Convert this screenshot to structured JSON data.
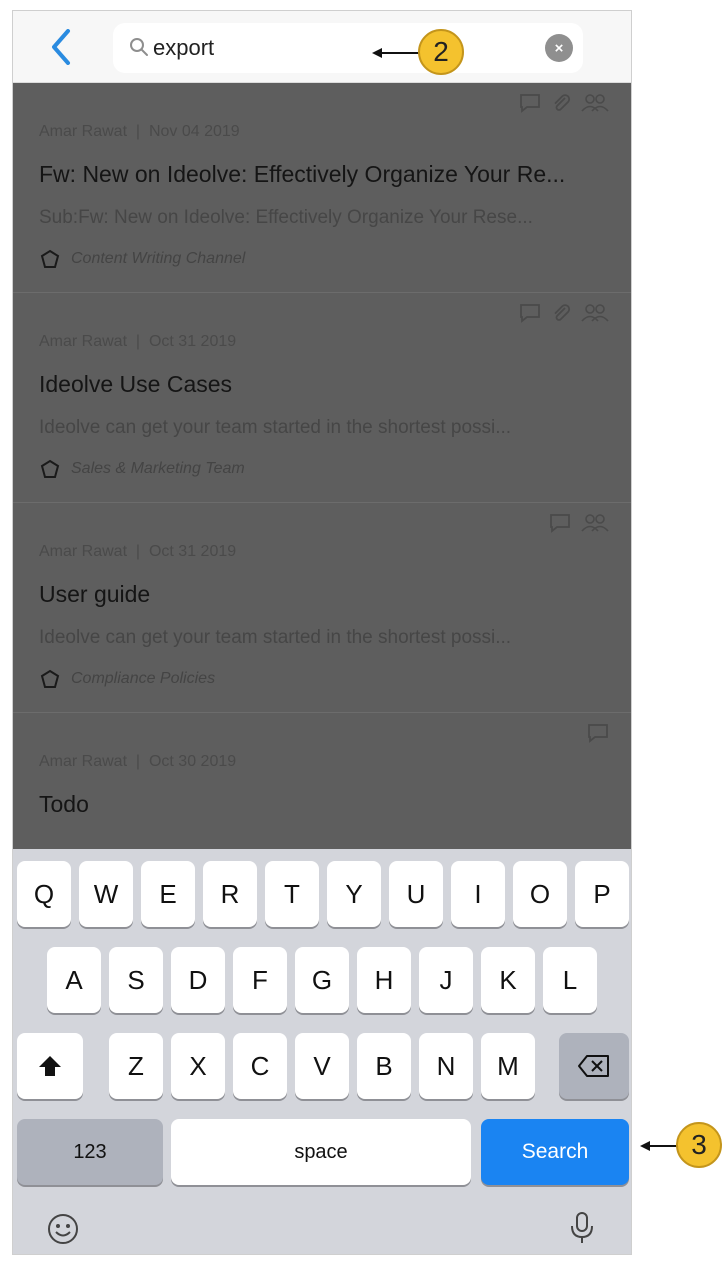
{
  "search": {
    "value": "export",
    "clear_label": "×"
  },
  "results": [
    {
      "author": "Amar Rawat",
      "separator": "|",
      "date": "Nov 04 2019",
      "title": "Fw: New on Ideolve: Effectively Organize Your Re...",
      "subtitle": "Sub:Fw: New on Ideolve: Effectively Organize Your Rese...",
      "channel": "Content Writing Channel"
    },
    {
      "author": "Amar Rawat",
      "separator": "|",
      "date": "Oct 31 2019",
      "title": "Ideolve Use Cases",
      "subtitle": "Ideolve can get your team started in the shortest possi...",
      "channel": "Sales & Marketing Team"
    },
    {
      "author": "Amar Rawat",
      "separator": "|",
      "date": "Oct 31 2019",
      "title": "User guide",
      "subtitle": "Ideolve can get your team started in the shortest possi...",
      "channel": "Compliance Policies"
    },
    {
      "author": "Amar Rawat",
      "separator": "|",
      "date": "Oct 30 2019",
      "title": "Todo"
    }
  ],
  "keyboard": {
    "row1": [
      "Q",
      "W",
      "E",
      "R",
      "T",
      "Y",
      "U",
      "I",
      "O",
      "P"
    ],
    "row2": [
      "A",
      "S",
      "D",
      "F",
      "G",
      "H",
      "J",
      "K",
      "L"
    ],
    "row3": [
      "Z",
      "X",
      "C",
      "V",
      "B",
      "N",
      "M"
    ],
    "numbers_label": "123",
    "space_label": "space",
    "search_label": "Search"
  },
  "callouts": {
    "search_field": "2",
    "search_key": "3"
  },
  "icons": {
    "back": "chevron-left-icon",
    "search": "magnifier-icon",
    "clear": "clear-icon",
    "comment": "comment-icon",
    "attachment": "paperclip-icon",
    "members": "people-icon",
    "channel": "channel-icon",
    "shift": "shift-icon",
    "backspace": "backspace-icon",
    "emoji": "emoji-icon",
    "mic": "microphone-icon"
  },
  "colors": {
    "accent": "#1a84f2",
    "back_chevron": "#2a8be0",
    "callout": "#f4c22e"
  }
}
